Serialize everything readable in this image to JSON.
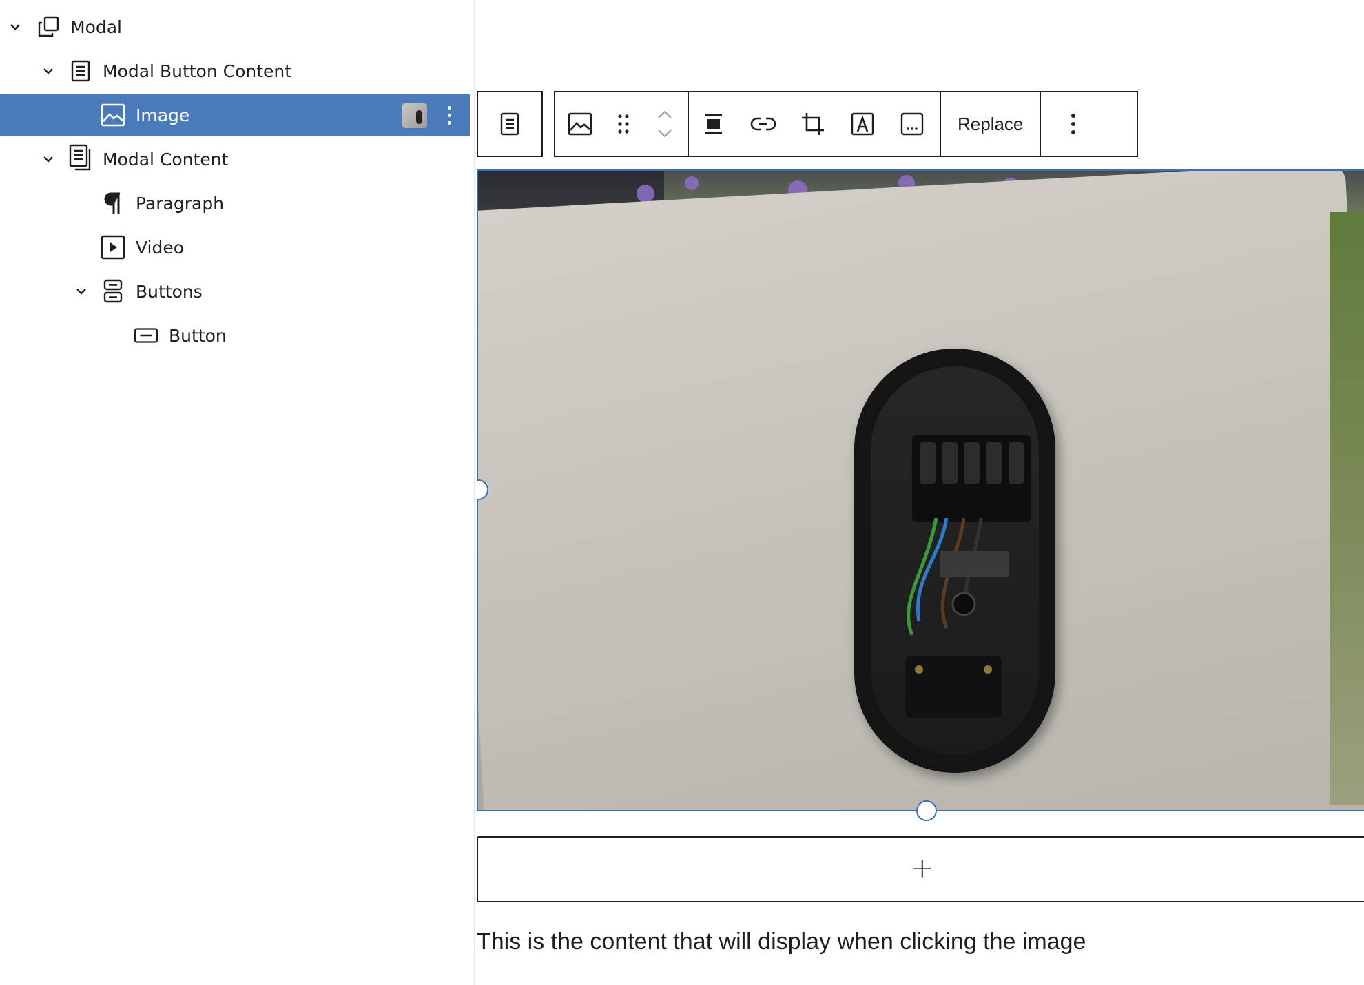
{
  "list_view": {
    "items": [
      {
        "label": "Modal",
        "icon": "modal-icon",
        "expanded": true,
        "selected": false
      },
      {
        "label": "Modal Button Content",
        "icon": "group-icon",
        "expanded": true,
        "selected": false
      },
      {
        "label": "Image",
        "icon": "image-icon",
        "expanded": null,
        "selected": true
      },
      {
        "label": "Modal Content",
        "icon": "group-icon",
        "expanded": true,
        "selected": false
      },
      {
        "label": "Paragraph",
        "icon": "paragraph-icon",
        "expanded": null,
        "selected": false
      },
      {
        "label": "Video",
        "icon": "video-icon",
        "expanded": null,
        "selected": false
      },
      {
        "label": "Buttons",
        "icon": "buttons-icon",
        "expanded": true,
        "selected": false
      },
      {
        "label": "Button",
        "icon": "button-icon",
        "expanded": null,
        "selected": false
      }
    ]
  },
  "toolbar": {
    "replace_label": "Replace",
    "icons": [
      "parent-block-icon",
      "image-icon",
      "drag-handle-icon",
      "move-up-icon",
      "move-down-icon",
      "align-icon",
      "link-icon",
      "crop-icon",
      "text-over-image-icon",
      "alt-text-icon",
      "more-options-icon"
    ]
  },
  "image_block": {
    "description_icon": "charger-photo"
  },
  "appender": {
    "label": "+"
  },
  "paragraph": {
    "text": "This is the content that will display when clicking the image"
  },
  "colors": {
    "selection": "#4a7ab9",
    "block_outline": "#3e6fb4",
    "text": "#1e1e1e"
  }
}
